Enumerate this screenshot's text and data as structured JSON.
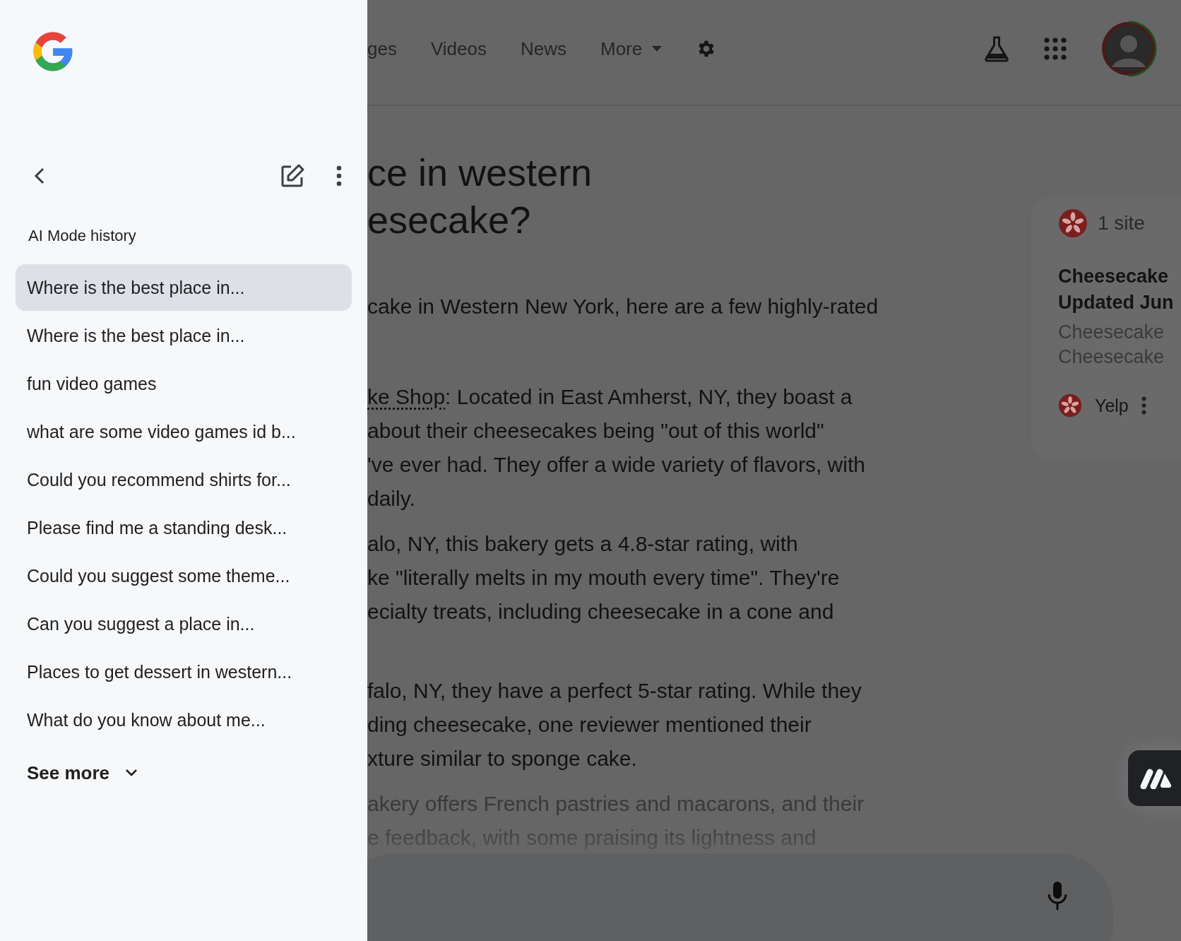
{
  "sidebar": {
    "history_title": "AI Mode history",
    "items": [
      {
        "label": "Where is the best place in...",
        "selected": true
      },
      {
        "label": "Where is the best place in...",
        "selected": false
      },
      {
        "label": "fun video games",
        "selected": false
      },
      {
        "label": "what are some video games id b...",
        "selected": false
      },
      {
        "label": "Could you recommend shirts for...",
        "selected": false
      },
      {
        "label": "Please find me a standing desk...",
        "selected": false
      },
      {
        "label": "Could you suggest some theme...",
        "selected": false
      },
      {
        "label": "Can you suggest a place in...",
        "selected": false
      },
      {
        "label": "Places to get dessert in western...",
        "selected": false
      },
      {
        "label": "What do you know about me...",
        "selected": false
      }
    ],
    "see_more": "See more"
  },
  "header": {
    "tabs": [
      {
        "label": "ges",
        "kind": "link"
      },
      {
        "label": "Videos",
        "kind": "link"
      },
      {
        "label": "News",
        "kind": "link"
      },
      {
        "label": "More",
        "kind": "menu"
      }
    ]
  },
  "answer": {
    "heading": [
      "ce in western",
      "esecake?"
    ],
    "paragraphs": [
      {
        "faded": false,
        "lines": [
          {
            "text": "cake in Western New York, here are a few highly-rated"
          }
        ]
      },
      {
        "faded": false,
        "lines": [
          {
            "link": "ke Shop",
            "text": ": Located in East Amherst, NY, they boast a"
          },
          {
            "text": "about their cheesecakes being \"out of this world\""
          },
          {
            "text": "'ve ever had. They offer a wide variety of flavors, with"
          },
          {
            "text": "daily."
          }
        ]
      },
      {
        "faded": false,
        "lines": [
          {
            "text": "alo, NY, this bakery gets a 4.8-star rating, with"
          },
          {
            "text": "ke \"literally melts in my mouth every time\". They're"
          },
          {
            "text": "ecialty treats, including cheesecake in a cone and"
          }
        ]
      },
      {
        "faded": false,
        "lines": [
          {
            "text": "falo, NY, they have a perfect 5-star rating. While they"
          },
          {
            "text": "ding cheesecake, one reviewer mentioned their"
          },
          {
            "text": "xture similar to sponge cake."
          }
        ]
      },
      {
        "faded": true,
        "lines": [
          {
            "text": "akery offers French pastries and macarons, and their"
          },
          {
            "text": "e feedback, with some praising its lightness and"
          }
        ]
      }
    ]
  },
  "source_card": {
    "count": "1 site",
    "title": [
      "Cheesecake",
      "Updated Jun"
    ],
    "snippet": [
      "Cheesecake",
      "Cheesecake"
    ],
    "site": "Yelp"
  }
}
